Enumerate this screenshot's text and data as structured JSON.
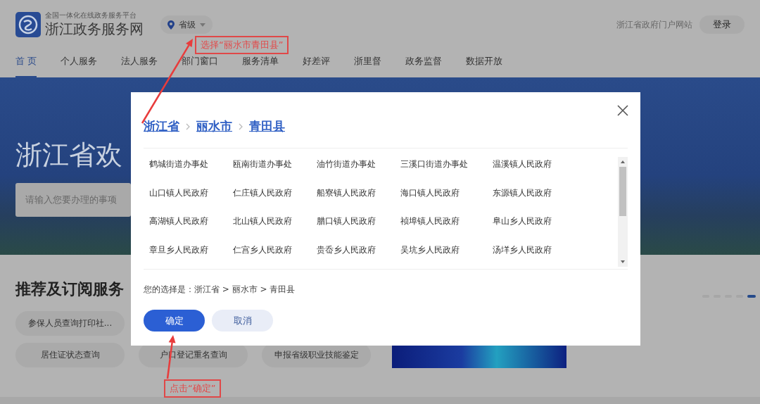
{
  "header": {
    "platform": "全国一体化在线政务服务平台",
    "site_name": "浙江政务服务网",
    "location": "省级",
    "portal_link": "浙江省政府门户网站",
    "login": "登录"
  },
  "nav": [
    {
      "label": "首 页",
      "selected": true
    },
    {
      "label": "个人服务",
      "selected": false
    },
    {
      "label": "法人服务",
      "selected": false
    },
    {
      "label": "部门窗口",
      "selected": false
    },
    {
      "label": "服务清单",
      "selected": false
    },
    {
      "label": "好差评",
      "selected": false
    },
    {
      "label": "浙里督",
      "selected": false
    },
    {
      "label": "政务监督",
      "selected": false
    },
    {
      "label": "数据开放",
      "selected": false
    }
  ],
  "hero": {
    "title": "浙江省欢",
    "search_placeholder": "请输入您要办理的事项"
  },
  "services": {
    "title": "推荐及订阅服务",
    "items": [
      "参保人员查询打印社...",
      "居住证状态查询",
      "户口登记重名查询",
      "申报省级职业技能鉴定"
    ]
  },
  "carousel_dots": [
    {
      "selected": false
    },
    {
      "selected": false
    },
    {
      "selected": false
    },
    {
      "selected": false
    },
    {
      "selected": true
    }
  ],
  "dialog": {
    "breadcrumb": [
      "浙江省",
      "丽水市",
      "青田县"
    ],
    "options": [
      "鹤城街道办事处",
      "瓯南街道办事处",
      "油竹街道办事处",
      "三溪口街道办事处",
      "温溪镇人民政府",
      "山口镇人民政府",
      "仁庄镇人民政府",
      "船寮镇人民政府",
      "海口镇人民政府",
      "东源镇人民政府",
      "高湖镇人民政府",
      "北山镇人民政府",
      "腊口镇人民政府",
      "祯埠镇人民政府",
      "阜山乡人民政府",
      "章旦乡人民政府",
      "仁宫乡人民政府",
      "贵岙乡人民政府",
      "吴坑乡人民政府",
      "汤垟乡人民政府"
    ],
    "selection": "您的选择是：浙江省 > 丽水市 > 青田县",
    "confirm": "确定",
    "cancel": "取消"
  },
  "annotations": [
    {
      "text": "选择“丽水市青田县”"
    },
    {
      "text": "点击“确定”"
    }
  ]
}
